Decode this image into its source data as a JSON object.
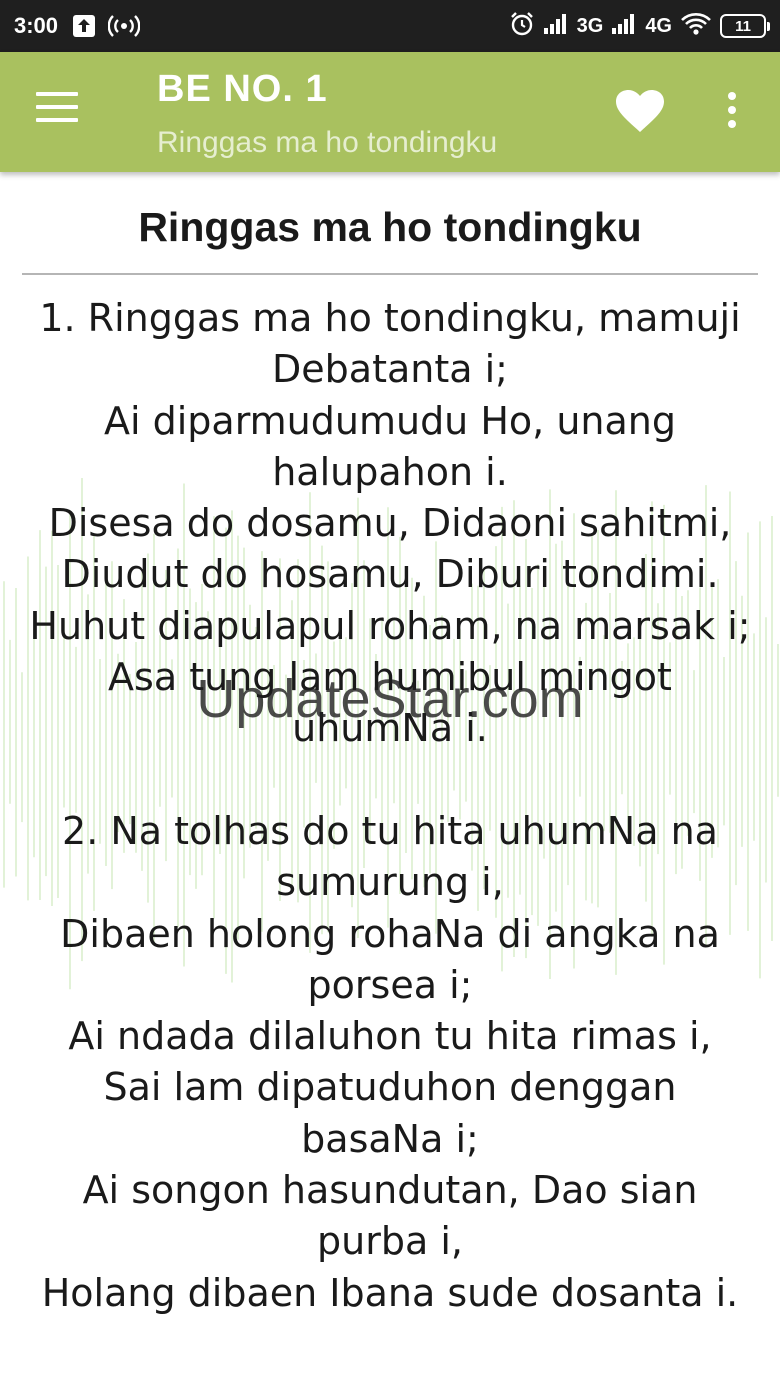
{
  "status_bar": {
    "time": "3:00",
    "network_3g": "3G",
    "network_4g": "4G",
    "battery": "11"
  },
  "app_bar": {
    "title": "BE NO. 1",
    "subtitle": "Ringgas ma ho tondingku",
    "background_color": "#a9c15f"
  },
  "song": {
    "title": "Ringgas ma ho tondingku",
    "verses": [
      [
        "1. Ringgas ma ho tondingku, mamuji",
        "Debatanta i;",
        "Ai diparmudumudu Ho, unang",
        "halupahon i.",
        "Disesa do dosamu, Didaoni sahitmi,",
        "Diudut do hosamu, Diburi tondimi.",
        "Huhut diapulapul roham, na marsak i;",
        "Asa tung lam humibul mingot",
        "uhumNa i."
      ],
      [
        "2. Na tolhas do tu hita uhumNa na",
        "sumurung i,",
        "Dibaen holong rohaNa di angka na",
        "porsea i;",
        "Ai ndada dilaluhon tu hita rimas i,",
        "Sai lam dipatuduhon denggan",
        "basaNa i;",
        "Ai songon hasundutan, Dao sian",
        "purba i,",
        "Holang dibaen Ibana sude dosanta i."
      ]
    ]
  },
  "watermark": "UpdateStar.com"
}
